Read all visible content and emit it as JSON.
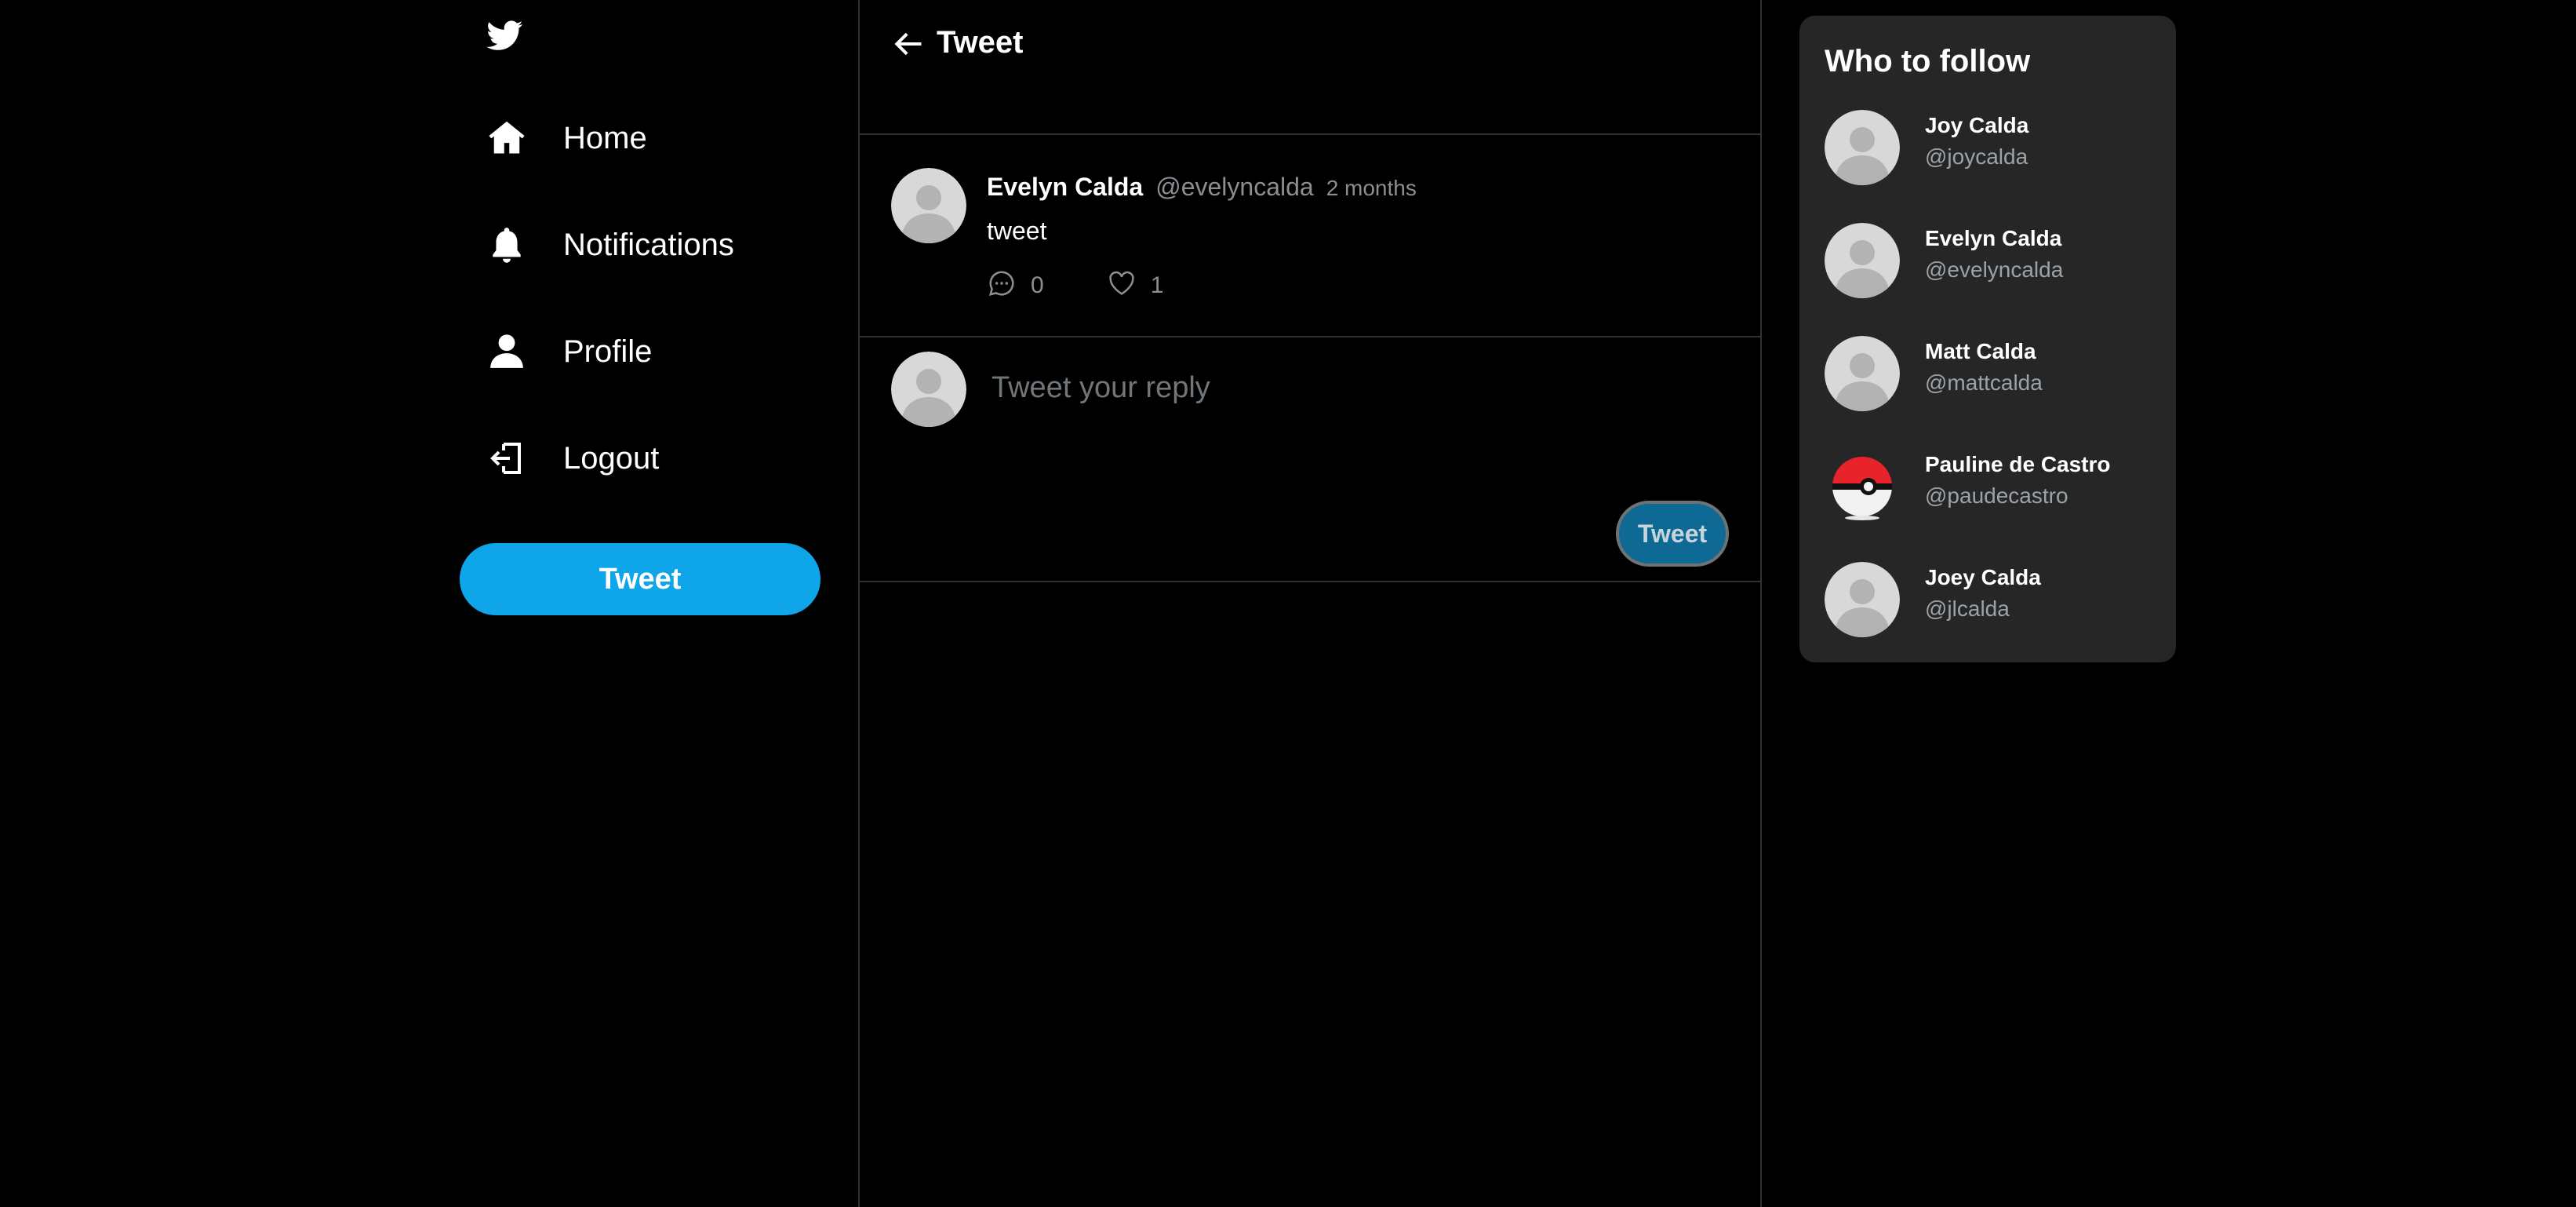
{
  "colors": {
    "accent": "#0ea5e9",
    "background": "#000000",
    "panel": "#262626",
    "muted": "#8b8f94"
  },
  "sidebar": {
    "logo_icon": "twitter-bird-icon",
    "items": [
      {
        "label": "Home",
        "icon": "home-icon"
      },
      {
        "label": "Notifications",
        "icon": "bell-icon"
      },
      {
        "label": "Profile",
        "icon": "person-icon"
      },
      {
        "label": "Logout",
        "icon": "logout-icon"
      }
    ],
    "tweet_button": "Tweet"
  },
  "main": {
    "header": {
      "title": "Tweet",
      "back_icon": "arrow-left-icon"
    },
    "tweet": {
      "name": "Evelyn Calda",
      "handle": "@evelyncalda",
      "time": "2 months",
      "text": "tweet",
      "replies": "0",
      "likes": "1"
    },
    "reply": {
      "placeholder": "Tweet your reply",
      "button": "Tweet"
    }
  },
  "who_to_follow": {
    "title": "Who to follow",
    "users": [
      {
        "name": "Joy Calda",
        "handle": "@joycalda",
        "avatar": "default"
      },
      {
        "name": "Evelyn Calda",
        "handle": "@evelyncalda",
        "avatar": "default"
      },
      {
        "name": "Matt Calda",
        "handle": "@mattcalda",
        "avatar": "default"
      },
      {
        "name": "Pauline de Castro",
        "handle": "@paudecastro",
        "avatar": "pokeball"
      },
      {
        "name": "Joey Calda",
        "handle": "@jlcalda",
        "avatar": "default"
      }
    ]
  }
}
